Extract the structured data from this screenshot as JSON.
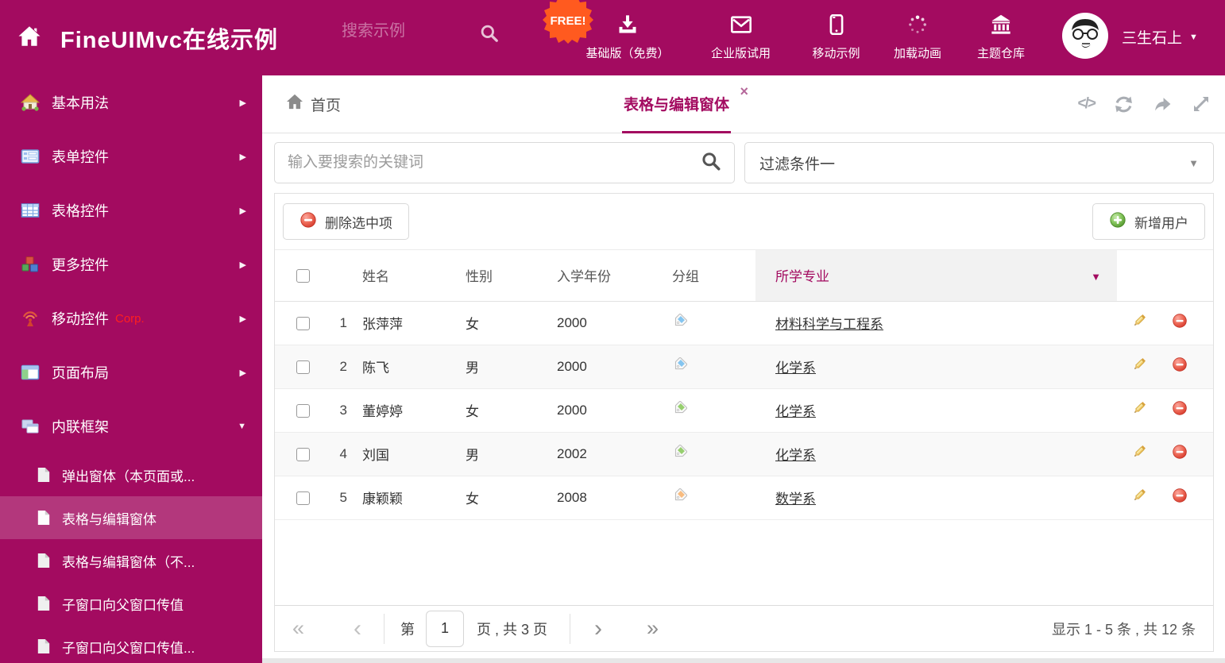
{
  "theme": {
    "accent": "#a30b60",
    "sidebar_selected": "rgba(255,255,255,0.18)",
    "free_badge_color": "#ff5a1f",
    "corp_color": "#ff1f1f",
    "link_color": "#333333",
    "delete_icon_color": "#e5493d",
    "add_icon_color": "#67b045",
    "major_header_bg": "#f2f2f2",
    "zebra_row_bg": "#f9f9f9"
  },
  "icons": {
    "caret_down": "▼",
    "caret_right": "▶",
    "close": "×",
    "code_glyph": "</>",
    "first": "«",
    "prev": "‹",
    "next": "›",
    "last": "»"
  },
  "header": {
    "title": "FineUIMvc在线示例",
    "search_placeholder": "搜索示例",
    "free_badge": "FREE!",
    "nav_items": [
      {
        "label": "基础版（免费）",
        "icon": "download-icon"
      },
      {
        "label": "企业版试用",
        "icon": "envelope-icon"
      },
      {
        "label": "移动示例",
        "icon": "phone-icon"
      },
      {
        "label": "加载动画",
        "icon": "spinner-icon"
      },
      {
        "label": "主题仓库",
        "icon": "bank-icon"
      }
    ],
    "username": "三生石上"
  },
  "sidebar": {
    "items": [
      {
        "label": "基本用法",
        "icon": "home-icon"
      },
      {
        "label": "表单控件",
        "icon": "form-icon"
      },
      {
        "label": "表格控件",
        "icon": "table-icon"
      },
      {
        "label": "更多控件",
        "icon": "cubes-icon"
      },
      {
        "label": "移动控件",
        "suffix": "Corp.",
        "icon": "antenna-icon"
      },
      {
        "label": "页面布局",
        "icon": "layout-icon"
      },
      {
        "label": "内联框架",
        "icon": "frames-icon",
        "expanded": true
      }
    ],
    "subitems": [
      {
        "label": "弹出窗体（本页面或..."
      },
      {
        "label": "表格与编辑窗体",
        "selected": true
      },
      {
        "label": "表格与编辑窗体（不..."
      },
      {
        "label": "子窗口向父窗口传值"
      },
      {
        "label": "子窗口向父窗口传值..."
      }
    ]
  },
  "tabs": {
    "home": "首页",
    "active": "表格与编辑窗体"
  },
  "filters": {
    "search_placeholder": "输入要搜索的关键词",
    "dropdown_value": "过滤条件一"
  },
  "toolbar": {
    "delete_label": "删除选中项",
    "add_label": "新增用户"
  },
  "table": {
    "headers": {
      "name": "姓名",
      "gender": "性别",
      "year": "入学年份",
      "group": "分组",
      "major": "所学专业"
    },
    "rows": [
      {
        "num": "1",
        "name": "张萍萍",
        "gender": "女",
        "year": "2000",
        "tag_color": "#85c5f0",
        "major": "材料科学与工程系"
      },
      {
        "num": "2",
        "name": "陈飞",
        "gender": "男",
        "year": "2000",
        "tag_color": "#85c5f0",
        "major": "化学系"
      },
      {
        "num": "3",
        "name": "董婷婷",
        "gender": "女",
        "year": "2000",
        "tag_color": "#97cf6f",
        "major": "化学系"
      },
      {
        "num": "4",
        "name": "刘国",
        "gender": "男",
        "year": "2002",
        "tag_color": "#97cf6f",
        "major": "化学系"
      },
      {
        "num": "5",
        "name": "康颖颖",
        "gender": "女",
        "year": "2008",
        "tag_color": "#f8bc80",
        "major": "数学系"
      }
    ]
  },
  "pagination": {
    "prefix": "第",
    "page": "1",
    "suffix": "页 , 共 3 页",
    "summary": "显示 1 - 5 条 , 共 12 条"
  }
}
